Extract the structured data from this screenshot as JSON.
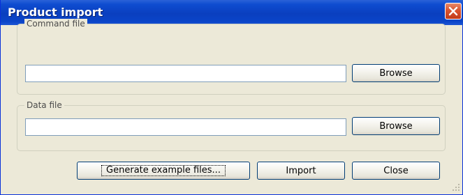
{
  "window": {
    "title": "Product import"
  },
  "command_file": {
    "group_label": "Command file",
    "value": "",
    "browse_label": "Browse"
  },
  "data_file": {
    "group_label": "Data file",
    "value": "",
    "browse_label": "Browse"
  },
  "actions": {
    "generate_label": "Generate example files...",
    "import_label": "Import",
    "close_label": "Close"
  },
  "icons": {
    "close": "close-icon",
    "resize": "resize-grip-icon"
  },
  "colors": {
    "titlebar": "#0a3fbf",
    "close_button": "#d9532f",
    "dialog_background": "#ece9d8"
  }
}
